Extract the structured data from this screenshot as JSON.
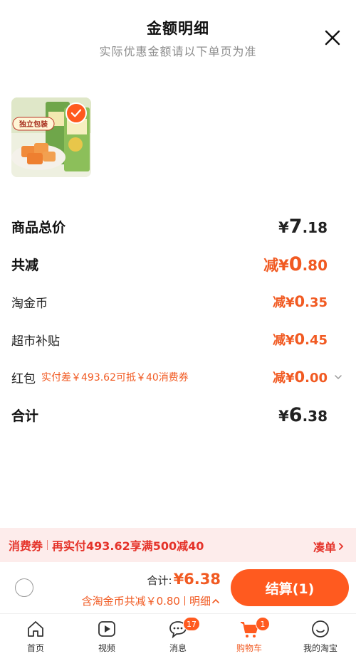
{
  "header": {
    "title": "金额明细",
    "subtitle": "实际优惠金额请以下单页为准"
  },
  "product": {
    "image_caption": "独立包装"
  },
  "breakdown": {
    "subtotal": {
      "label": "商品总价",
      "currency": "¥",
      "int": "7",
      "dec": ".18"
    },
    "total_discount": {
      "label": "共减",
      "prefix": "减",
      "currency": "¥",
      "int": "0",
      "dec": ".80"
    },
    "coins": {
      "label": "淘金币",
      "prefix": "减",
      "currency": "¥",
      "int": "0",
      "dec": ".35"
    },
    "subsidy": {
      "label": "超市补贴",
      "prefix": "减",
      "currency": "¥",
      "int": "0",
      "dec": ".45"
    },
    "red_packet": {
      "label": "红包",
      "note": "实付差￥493.62可抵￥40消费券",
      "prefix": "减",
      "currency": "¥",
      "int": "0",
      "dec": ".00"
    },
    "total": {
      "label": "合计",
      "currency": "¥",
      "int": "6",
      "dec": ".38"
    }
  },
  "coupon_bar": {
    "tag": "消费券",
    "text": "再实付493.62享满500减40",
    "link": "凑单"
  },
  "checkout": {
    "total_label": "合计:",
    "total_value": "¥6.38",
    "coins_note": "含淘金币共减￥0.80",
    "detail_label": "明细",
    "button_label": "结算(1)"
  },
  "tabs": [
    {
      "label": "首页",
      "icon": "home-icon"
    },
    {
      "label": "视频",
      "icon": "video-icon"
    },
    {
      "label": "消息",
      "icon": "message-icon",
      "badge": "17"
    },
    {
      "label": "购物车",
      "icon": "cart-icon",
      "badge": "1",
      "active": true
    },
    {
      "label": "我的淘宝",
      "icon": "profile-icon"
    }
  ],
  "colors": {
    "accent": "#ff5a1f",
    "discount": "#f15a22",
    "coupon_bg": "#fdeceb",
    "coupon_text": "#e5332a"
  }
}
